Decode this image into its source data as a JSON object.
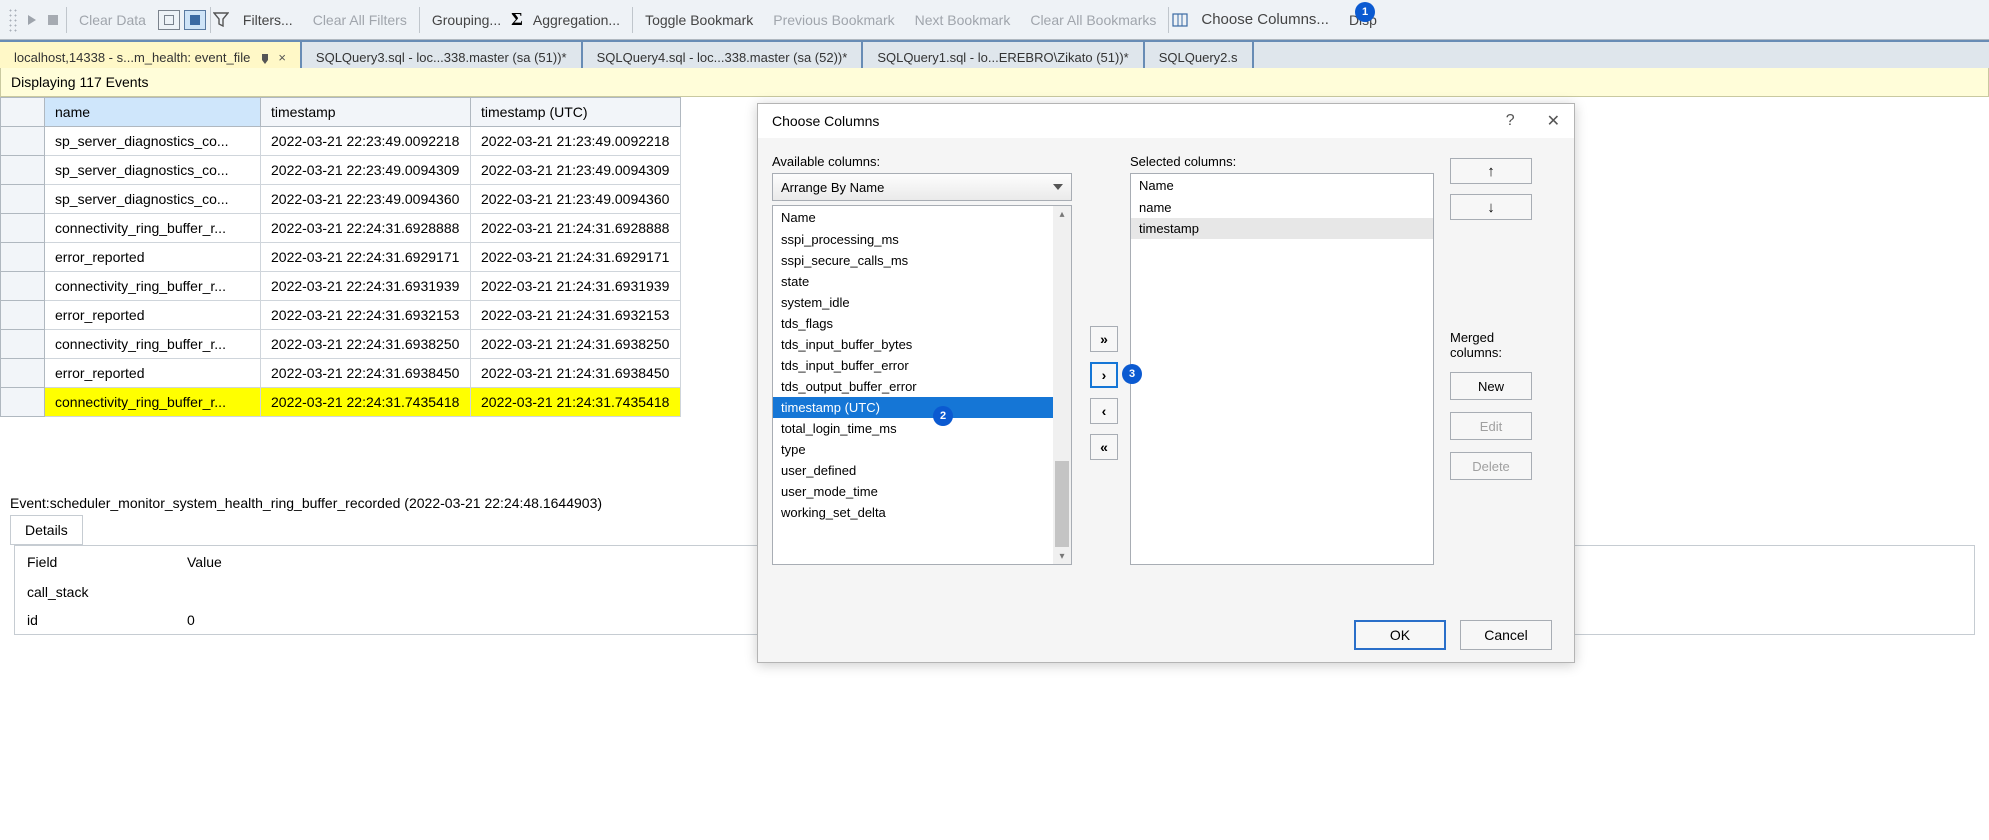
{
  "toolbar": {
    "clear_data": "Clear Data",
    "filters": "Filters...",
    "clear_all_filters": "Clear All Filters",
    "grouping": "Grouping...",
    "aggregation": "Aggregation...",
    "toggle_bookmark": "Toggle Bookmark",
    "previous_bookmark": "Previous Bookmark",
    "next_bookmark": "Next Bookmark",
    "clear_all_bookmarks": "Clear All Bookmarks",
    "choose_columns": "Choose Columns...",
    "display": "Disp"
  },
  "badges": {
    "b1": "1",
    "b2": "2",
    "b3": "3"
  },
  "tabs": [
    {
      "label": "localhost,14338 - s...m_health: event_file",
      "active": true,
      "pinned": true,
      "closable": true
    },
    {
      "label": "SQLQuery3.sql - loc...338.master (sa (51))*"
    },
    {
      "label": "SQLQuery4.sql - loc...338.master (sa (52))*"
    },
    {
      "label": "SQLQuery1.sql - lo...EREBRO\\Zikato (51))*"
    },
    {
      "label": "SQLQuery2.s"
    }
  ],
  "status_line": "Displaying 117 Events",
  "grid": {
    "columns": [
      "name",
      "timestamp",
      "timestamp (UTC)"
    ],
    "rows": [
      {
        "name": "sp_server_diagnostics_co...",
        "ts": "2022-03-21 22:23:49.0092218",
        "utc": "2022-03-21 21:23:49.0092218"
      },
      {
        "name": "sp_server_diagnostics_co...",
        "ts": "2022-03-21 22:23:49.0094309",
        "utc": "2022-03-21 21:23:49.0094309"
      },
      {
        "name": "sp_server_diagnostics_co...",
        "ts": "2022-03-21 22:23:49.0094360",
        "utc": "2022-03-21 21:23:49.0094360"
      },
      {
        "name": "connectivity_ring_buffer_r...",
        "ts": "2022-03-21 22:24:31.6928888",
        "utc": "2022-03-21 21:24:31.6928888"
      },
      {
        "name": "error_reported",
        "ts": "2022-03-21 22:24:31.6929171",
        "utc": "2022-03-21 21:24:31.6929171"
      },
      {
        "name": "connectivity_ring_buffer_r...",
        "ts": "2022-03-21 22:24:31.6931939",
        "utc": "2022-03-21 21:24:31.6931939"
      },
      {
        "name": "error_reported",
        "ts": "2022-03-21 22:24:31.6932153",
        "utc": "2022-03-21 21:24:31.6932153"
      },
      {
        "name": "connectivity_ring_buffer_r...",
        "ts": "2022-03-21 22:24:31.6938250",
        "utc": "2022-03-21 21:24:31.6938250"
      },
      {
        "name": "error_reported",
        "ts": "2022-03-21 22:24:31.6938450",
        "utc": "2022-03-21 21:24:31.6938450"
      },
      {
        "name": "connectivity_ring_buffer_r...",
        "ts": "2022-03-21 22:24:31.7435418",
        "utc": "2022-03-21 21:24:31.7435418",
        "highlight": true
      }
    ]
  },
  "event_line": "Event:scheduler_monitor_system_health_ring_buffer_recorded (2022-03-21 22:24:48.1644903)",
  "details_tab": "Details",
  "details": {
    "field_hdr": "Field",
    "value_hdr": "Value",
    "rows": [
      {
        "field": "call_stack",
        "value": ""
      },
      {
        "field": "id",
        "value": "0"
      }
    ]
  },
  "dialog": {
    "title": "Choose Columns",
    "available_label": "Available columns:",
    "selected_label": "Selected columns:",
    "arrange_by": "Arrange By Name",
    "list_header": "Name",
    "available_items": [
      "sspi_processing_ms",
      "sspi_secure_calls_ms",
      "state",
      "system_idle",
      "tds_flags",
      "tds_input_buffer_bytes",
      "tds_input_buffer_error",
      "tds_output_buffer_error",
      "timestamp (UTC)",
      "total_login_time_ms",
      "type",
      "user_defined",
      "user_mode_time",
      "working_set_delta"
    ],
    "selected_header": "Name",
    "selected_items": [
      "name",
      "timestamp"
    ],
    "merged_label": "Merged columns:",
    "btn_new": "New",
    "btn_edit": "Edit",
    "btn_delete": "Delete",
    "btn_ok": "OK",
    "btn_cancel": "Cancel",
    "help": "?",
    "close": "✕",
    "mv_all_right": "»",
    "mv_right": "›",
    "mv_left": "‹",
    "mv_all_left": "«",
    "up": "↑",
    "down": "↓"
  }
}
